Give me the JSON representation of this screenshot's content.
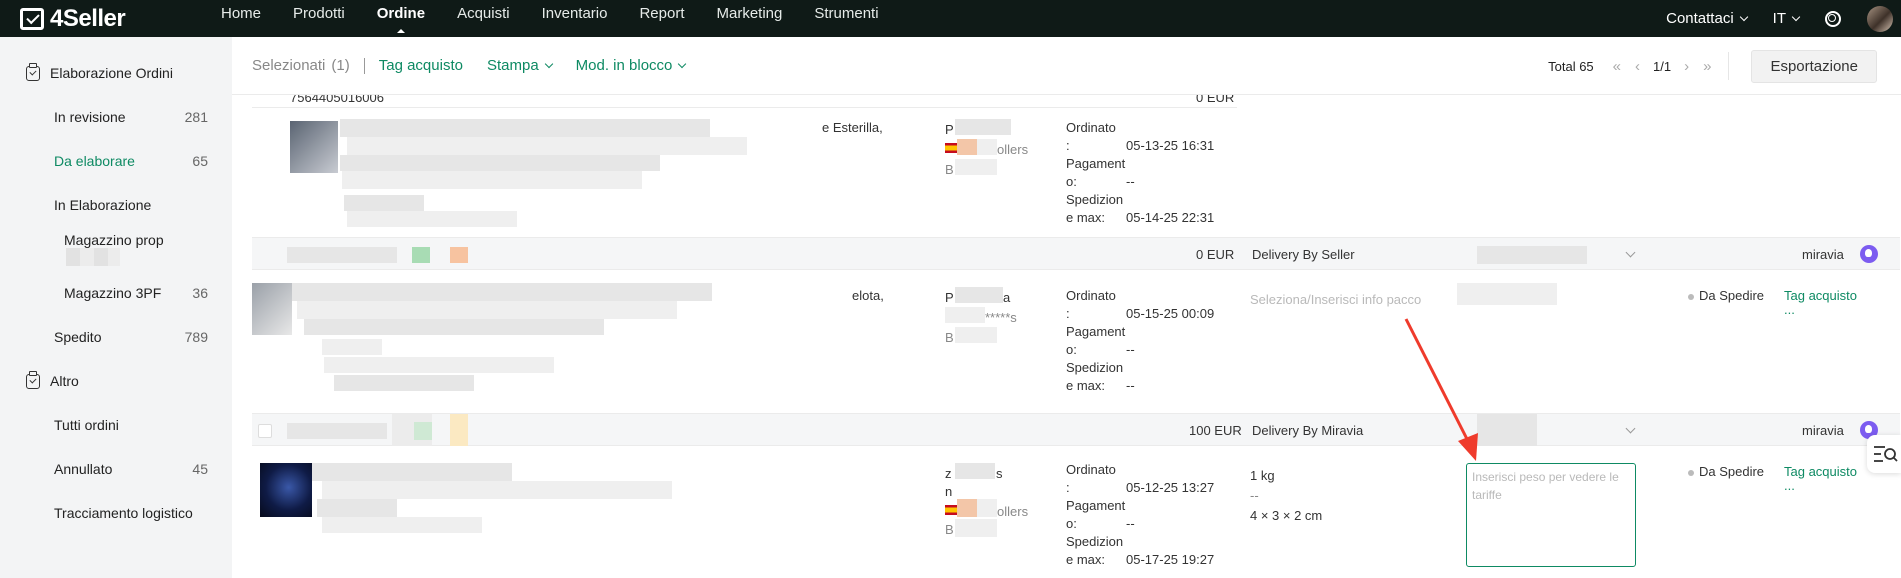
{
  "app": {
    "logo": "4Seller"
  },
  "nav": {
    "items": [
      {
        "label": "Home",
        "active": false
      },
      {
        "label": "Prodotti",
        "active": false
      },
      {
        "label": "Ordine",
        "active": true
      },
      {
        "label": "Acquisti",
        "active": false
      },
      {
        "label": "Inventario",
        "active": false
      },
      {
        "label": "Report",
        "active": false
      },
      {
        "label": "Marketing",
        "active": false
      },
      {
        "label": "Strumenti",
        "active": false
      }
    ],
    "contact": "Contattaci",
    "language": "IT"
  },
  "sidebar": {
    "group1": "Elaborazione Ordini",
    "items": [
      {
        "label": "In revisione",
        "count": "281"
      },
      {
        "label": "Da elaborare",
        "count": "65"
      },
      {
        "label": "In Elaborazione",
        "count": ""
      },
      {
        "label": "Magazzino prop",
        "count": ""
      },
      {
        "label": "Magazzino 3PF",
        "count": "36"
      },
      {
        "label": "Spedito",
        "count": "789"
      }
    ],
    "group2": "Altro",
    "items2": [
      {
        "label": "Tutti ordini",
        "count": ""
      },
      {
        "label": "Annullato",
        "count": "45"
      },
      {
        "label": "Tracciamento logistico",
        "count": ""
      }
    ]
  },
  "toolbar": {
    "selected_label": "Selezionati",
    "selected_count": "(1)",
    "tag": "Tag acquisto",
    "print": "Stampa",
    "bulk": "Mod. in blocco",
    "total": "Total 65",
    "page": "1/1",
    "export": "Esportazione"
  },
  "orders": {
    "top_partial": {
      "order_no": "7564405016006",
      "amount": "0 EUR"
    },
    "row1": {
      "address_tail": "e Esterilla,",
      "buyer_prefix": "P",
      "seller_suffix": "ollers",
      "buyer_b": "B",
      "ordered_label": "Ordinato",
      "colon": ":",
      "ordered_value": "05-13-25 16:31",
      "payment_label_1": "Pagament",
      "payment_label_2": "o:",
      "payment_value": "--",
      "ship_label_1": "Spedizion",
      "ship_label_2": "e max:",
      "ship_value": "05-14-25 22:31"
    },
    "row2_header": {
      "amount": "0 EUR",
      "delivery": "Delivery By Seller",
      "channel": "miravia"
    },
    "row2": {
      "address_tail": "elota,",
      "buyer_prefix": "P",
      "buyer_suffix": "a",
      "seller_masked": "*****s",
      "buyer_b": "B",
      "ordered_value": "05-15-25 00:09",
      "payment_value": "--",
      "ship_value": "--",
      "package_placeholder": "Seleziona/Inserisci info pacco",
      "status": "Da Spedire",
      "tag": "Tag acquisto",
      "more": "..."
    },
    "row3_header": {
      "amount": "100 EUR",
      "delivery": "Delivery By Miravia",
      "channel": "miravia"
    },
    "row3": {
      "buyer_prefix": "z",
      "buyer_suffix": "s",
      "buyer_n": "n",
      "seller_suffix": "ollers",
      "buyer_b": "B",
      "ordered_value": "05-12-25 13:27",
      "payment_value": "--",
      "ship_value": "05-17-25 19:27",
      "weight": "1 kg",
      "dash": "--",
      "dimensions": "4 × 3 × 2 cm",
      "weight_placeholder": "Inserisci peso per vedere le tariffe",
      "status": "Da Spedire",
      "tag": "Tag acquisto",
      "more": "..."
    }
  },
  "colors": {
    "accent": "#0e8a63",
    "topbar": "#0f1a17",
    "red": "#e53935",
    "miravia": "#7c5cf0"
  }
}
